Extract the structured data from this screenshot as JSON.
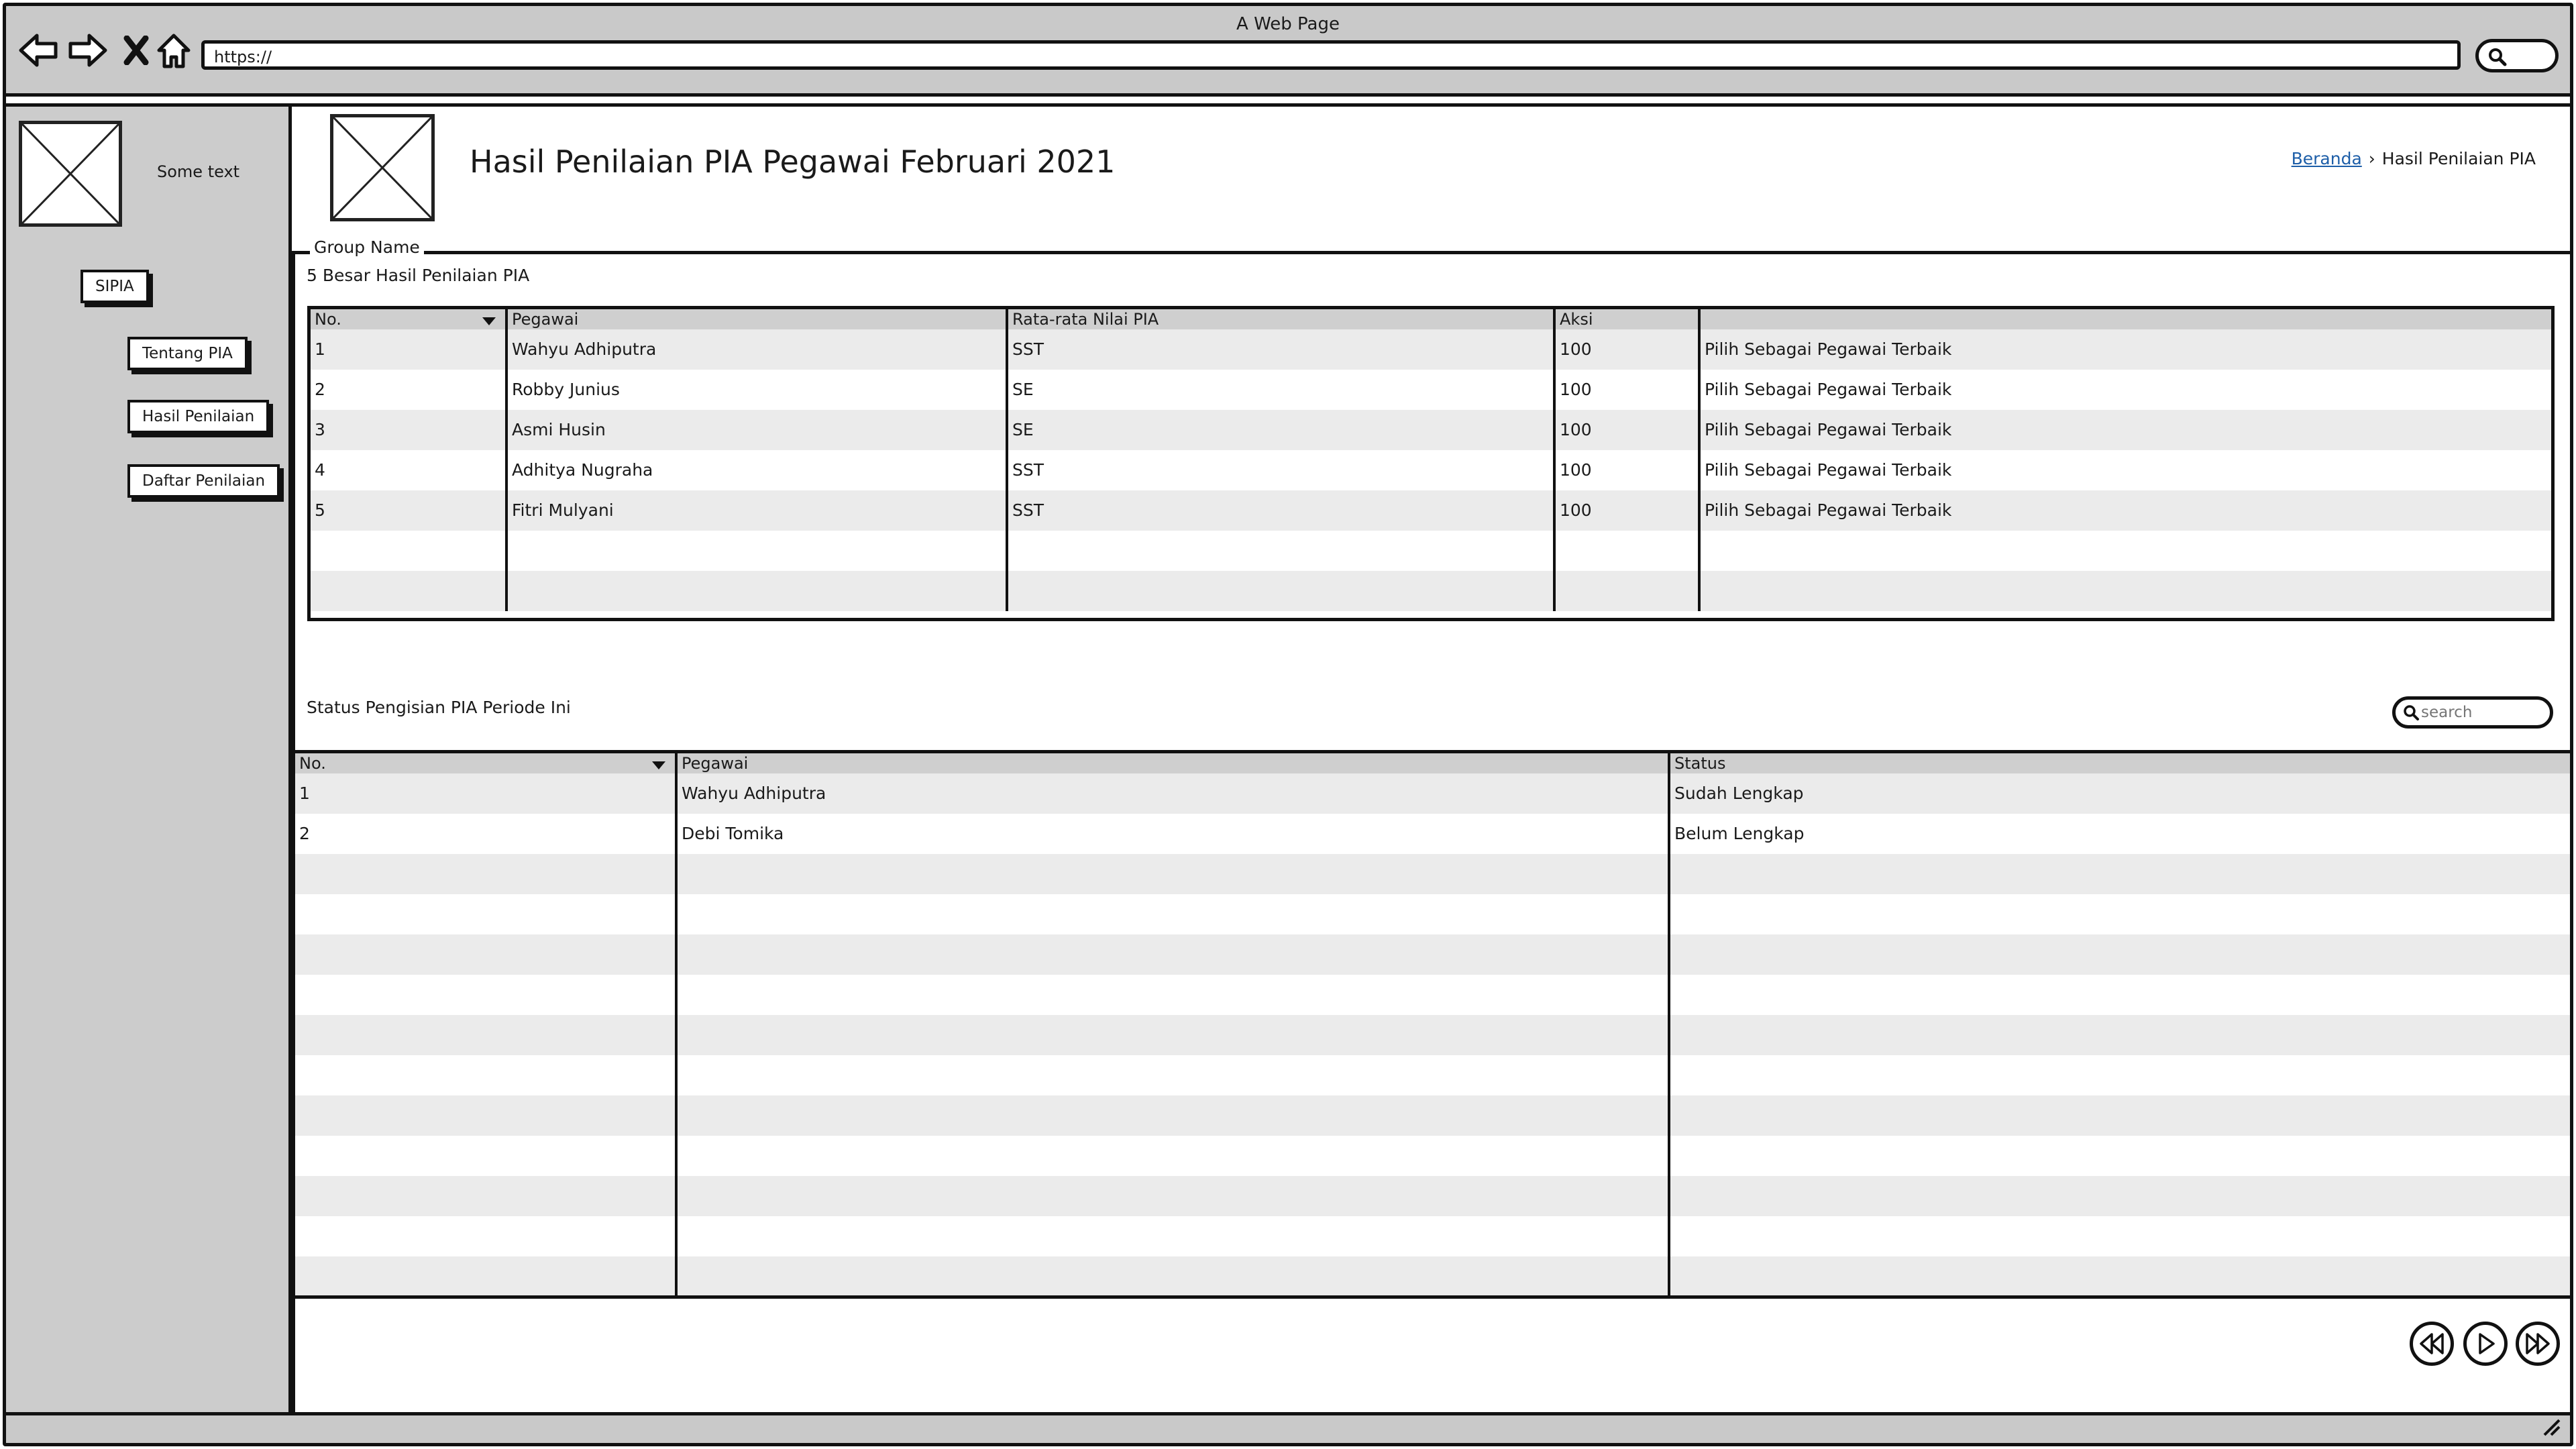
{
  "window": {
    "title": "A Web Page"
  },
  "browser": {
    "url": "https://",
    "nav_icons": [
      "back-arrow-icon",
      "forward-arrow-icon",
      "close-x-icon",
      "home-icon"
    ]
  },
  "sidebar": {
    "logo_text": "Some text",
    "app_button": "SIPIA",
    "items": [
      {
        "label": "Tentang PIA"
      },
      {
        "label": "Hasil Penilaian"
      },
      {
        "label": "Daftar Penilaian"
      }
    ]
  },
  "header": {
    "title": "Hasil Penilaian PIA Pegawai Februari 2021",
    "breadcrumb": {
      "home": "Beranda",
      "separator": "›",
      "current": "Hasil Penilaian PIA"
    }
  },
  "group": {
    "name": "Group Name"
  },
  "top_table": {
    "title": "5 Besar Hasil Penilaian PIA",
    "columns": [
      "No.",
      "Pegawai",
      "Rata-rata Nilai PIA",
      "Aksi",
      ""
    ],
    "rows": [
      [
        "1",
        "Wahyu Adhiputra",
        "SST",
        "100",
        "Pilih Sebagai Pegawai Terbaik"
      ],
      [
        "2",
        "Robby Junius",
        "SE",
        "100",
        "Pilih Sebagai Pegawai Terbaik"
      ],
      [
        "3",
        "Asmi Husin",
        "SE",
        "100",
        "Pilih Sebagai Pegawai Terbaik"
      ],
      [
        "4",
        "Adhitya Nugraha",
        "SST",
        "100",
        "Pilih Sebagai Pegawai Terbaik"
      ],
      [
        "5",
        "Fitri Mulyani",
        "SST",
        "100",
        "Pilih Sebagai Pegawai Terbaik"
      ],
      [
        "",
        "",
        "",
        "",
        ""
      ],
      [
        "",
        "",
        "",
        "",
        ""
      ]
    ]
  },
  "status_table": {
    "title": "Status Pengisian PIA Periode Ini",
    "search_placeholder": "search",
    "columns": [
      "No.",
      "Pegawai",
      "Status"
    ],
    "rows": [
      [
        "1",
        "Wahyu Adhiputra",
        "Sudah Lengkap"
      ],
      [
        "2",
        "Debi Tomika",
        "Belum Lengkap"
      ],
      [
        "",
        "",
        ""
      ],
      [
        "",
        "",
        ""
      ],
      [
        "",
        "",
        ""
      ],
      [
        "",
        "",
        ""
      ],
      [
        "",
        "",
        ""
      ],
      [
        "",
        "",
        ""
      ],
      [
        "",
        "",
        ""
      ],
      [
        "",
        "",
        ""
      ],
      [
        "",
        "",
        ""
      ],
      [
        "",
        "",
        ""
      ],
      [
        "",
        "",
        ""
      ]
    ]
  },
  "pagination": {
    "icons": [
      "rewind-icon",
      "play-icon",
      "fast-forward-icon"
    ]
  }
}
